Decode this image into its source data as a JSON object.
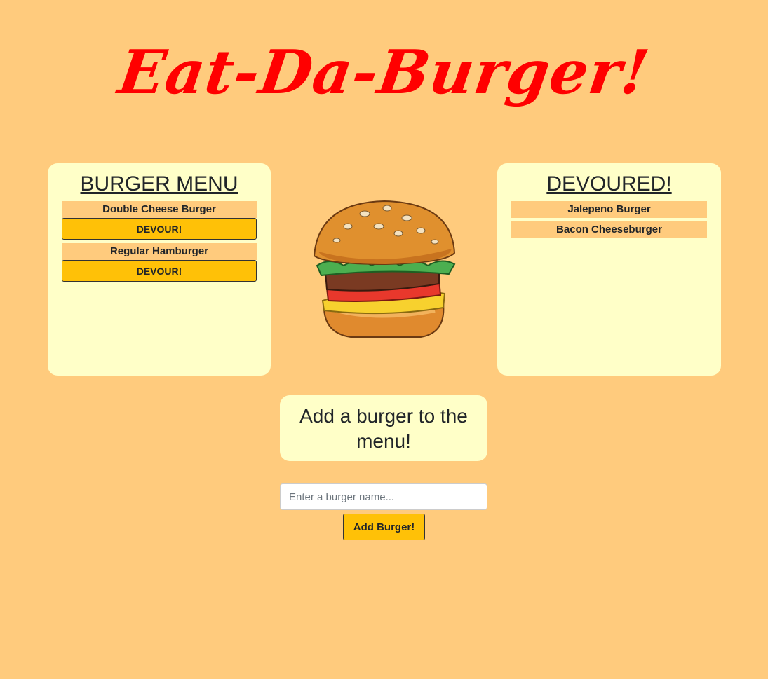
{
  "header": {
    "title": "Eat-Da-Burger!"
  },
  "menu": {
    "heading": "BURGER MENU",
    "items": [
      {
        "name": "Double Cheese Burger",
        "button": "DEVOUR!"
      },
      {
        "name": "Regular Hamburger",
        "button": "DEVOUR!"
      }
    ]
  },
  "devoured": {
    "heading": "DEVOURED!",
    "items": [
      {
        "name": "Jalepeno Burger"
      },
      {
        "name": "Bacon Cheeseburger"
      }
    ]
  },
  "add": {
    "heading": "Add a burger to the menu!",
    "placeholder": "Enter a burger name...",
    "button": "Add Burger!"
  },
  "image": {
    "icon": "burger-illustration"
  },
  "colors": {
    "background": "#FFCB7D",
    "title": "#FF0000",
    "panel": "#FFFFC8",
    "button": "#FFC107"
  }
}
